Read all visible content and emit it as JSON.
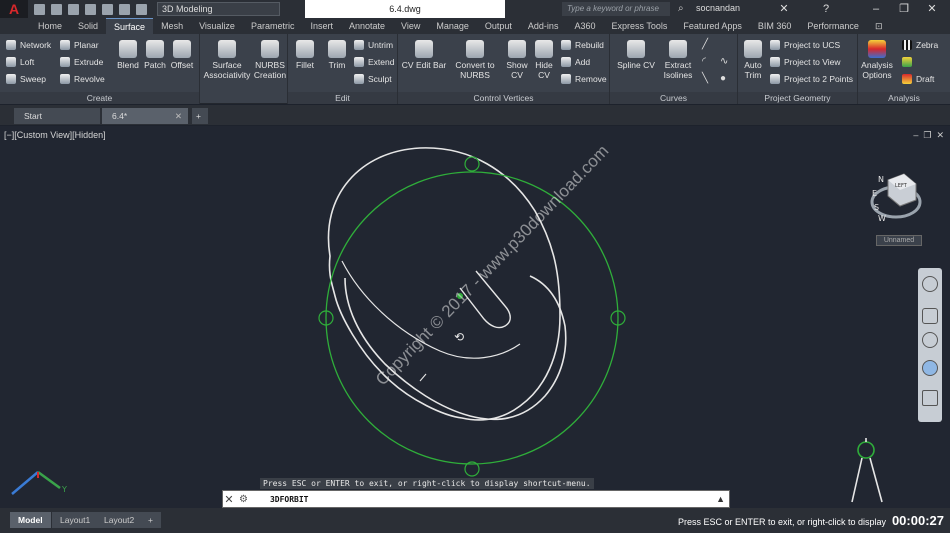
{
  "titlebar": {
    "logo": "A",
    "workspace": "3D Modeling",
    "document": "6.4.dwg",
    "search_placeholder": "Type a keyword or phrase",
    "user": "socnandan"
  },
  "ribbon_tabs": [
    "Home",
    "Solid",
    "Surface",
    "Mesh",
    "Visualize",
    "Parametric",
    "Insert",
    "Annotate",
    "View",
    "Manage",
    "Output",
    "Add-ins",
    "A360",
    "Express Tools",
    "Featured Apps",
    "BIM 360",
    "Performance"
  ],
  "active_tab": "Surface",
  "panels": {
    "create": {
      "title": "Create",
      "small": [
        "Network",
        "Loft",
        "Sweep",
        "Planar",
        "Extrude",
        "Revolve"
      ],
      "large": [
        "Blend",
        "Patch",
        "Offset",
        "Surface Associativity",
        "NURBS Creation"
      ]
    },
    "edit": {
      "title": "Edit",
      "large": [
        "Fillet",
        "Trim"
      ],
      "small": [
        "Untrim",
        "Extend",
        "Sculpt"
      ]
    },
    "control_vertices": {
      "title": "Control Vertices",
      "large": [
        "CV Edit Bar",
        "Convert to NURBS",
        "Show CV",
        "Hide CV"
      ],
      "small": [
        "Rebuild",
        "Add",
        "Remove"
      ]
    },
    "curves": {
      "title": "Curves",
      "large": [
        "Spline CV",
        "Extract Isolines"
      ]
    },
    "project_geometry": {
      "title": "Project Geometry",
      "large": [
        "Auto Trim"
      ],
      "small": [
        "Project to UCS",
        "Project to View",
        "Project to 2 Points"
      ]
    },
    "analysis": {
      "title": "Analysis",
      "large": [
        "Analysis Options"
      ],
      "small": [
        "Zebra",
        "Draft"
      ]
    }
  },
  "file_tabs": [
    "Start",
    "6.4*"
  ],
  "drawing": {
    "view_label": "[−][Custom View][Hidden]",
    "ucs_label": "Unnamed",
    "viewcube_directions": [
      "N",
      "E",
      "S",
      "W"
    ],
    "viewcube_face": "LEFT",
    "watermark": "Copyright © 2017 - www.p30download.com"
  },
  "command": {
    "hint": "Press ESC or ENTER to exit, or right-click to display shortcut-menu.",
    "input": "3DFORBIT"
  },
  "layout_tabs": [
    "Model",
    "Layout1",
    "Layout2"
  ],
  "status": {
    "text": "Press ESC or ENTER to exit, or right-click to display",
    "timer": "00:00:27"
  },
  "colors": {
    "orbit_circle": "#2fae3a",
    "sketch_stroke": "#e6e6e6",
    "accent_red": "#d8282b"
  }
}
